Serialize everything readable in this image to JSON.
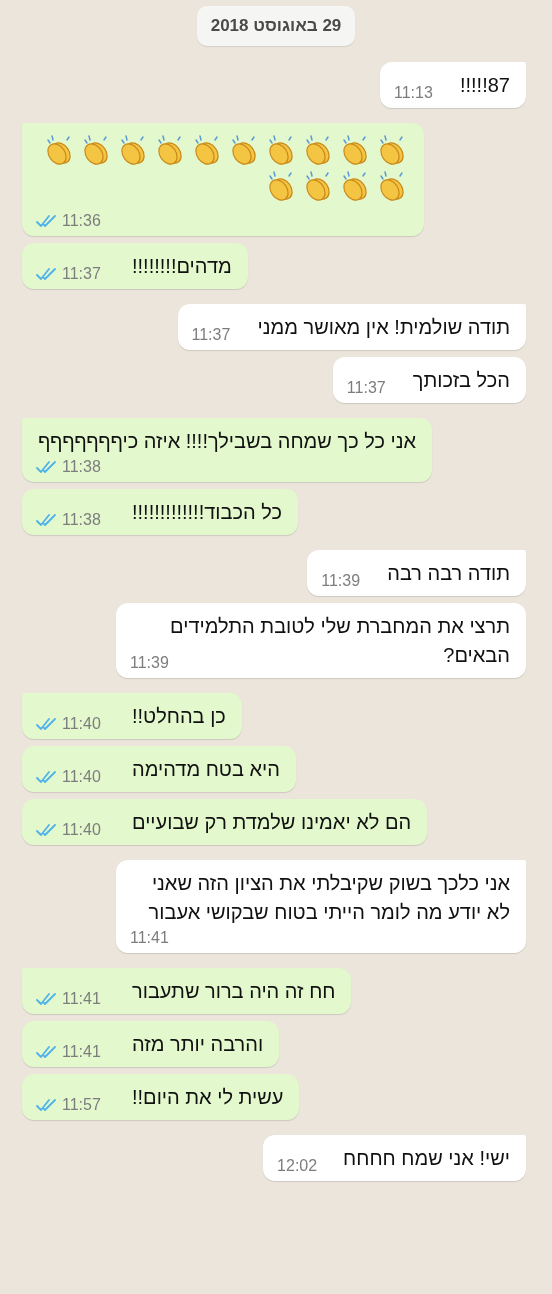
{
  "date_chip": "29 באוגוסט 2018",
  "messages": [
    {
      "kind": "text",
      "outgoing": false,
      "text": "87!!!!!",
      "time": "11:13"
    },
    {
      "kind": "emoji",
      "outgoing": true,
      "read": true,
      "emojis": [
        {
          "kind": "clap"
        },
        {
          "kind": "clap"
        },
        {
          "kind": "clap"
        },
        {
          "kind": "clap"
        },
        {
          "kind": "clap"
        },
        {
          "kind": "clap"
        },
        {
          "kind": "clap"
        },
        {
          "kind": "clap"
        },
        {
          "kind": "clap"
        },
        {
          "kind": "clap"
        },
        {
          "kind": "clap"
        },
        {
          "kind": "clap"
        },
        {
          "kind": "clap"
        },
        {
          "kind": "clap"
        }
      ],
      "time": "11:36"
    },
    {
      "kind": "text",
      "outgoing": true,
      "read": true,
      "text": "מדהים!!!!!!!!",
      "time": "11:37"
    },
    {
      "kind": "text",
      "outgoing": false,
      "text": "תודה שולמית! אין מאושר ממני",
      "time": "11:37"
    },
    {
      "kind": "text",
      "outgoing": false,
      "text": "הכל בזכותך",
      "time": "11:37"
    },
    {
      "kind": "text",
      "outgoing": true,
      "read": true,
      "text": "אני כל כך שמחה בשבילך!!!! איזה כיףףףףףףף",
      "time": "11:38"
    },
    {
      "kind": "text",
      "outgoing": true,
      "read": true,
      "text": "כל הכבוד!!!!!!!!!!!!!",
      "time": "11:38"
    },
    {
      "kind": "text",
      "outgoing": false,
      "text": "תודה רבה רבה",
      "time": "11:39"
    },
    {
      "kind": "text",
      "outgoing": false,
      "text": "תרצי את המחברת שלי לטובת התלמידים הבאים?",
      "time": "11:39"
    },
    {
      "kind": "text",
      "outgoing": true,
      "read": true,
      "text": "כן בהחלט!!",
      "time": "11:40"
    },
    {
      "kind": "text",
      "outgoing": true,
      "read": true,
      "text": "היא בטח מדהימה",
      "time": "11:40"
    },
    {
      "kind": "text",
      "outgoing": true,
      "read": true,
      "text": "הם לא יאמינו שלמדת רק שבועיים",
      "time": "11:40"
    },
    {
      "kind": "text",
      "outgoing": false,
      "text": "אני כלכך בשוק שקיבלתי את הציון הזה שאני לא יודע מה לומר הייתי בטוח שבקושי אעבור",
      "time": "11:41"
    },
    {
      "kind": "text",
      "outgoing": true,
      "read": true,
      "text": "חח זה היה ברור שתעבור",
      "time": "11:41"
    },
    {
      "kind": "text",
      "outgoing": true,
      "read": true,
      "text": "והרבה יותר מזה",
      "time": "11:41"
    },
    {
      "kind": "text",
      "outgoing": true,
      "read": true,
      "text": "עשית לי את היום!!",
      "time": "11:57"
    },
    {
      "kind": "text",
      "outgoing": false,
      "text": "ישי! אני שמח חחחח",
      "time": "12:02"
    }
  ]
}
